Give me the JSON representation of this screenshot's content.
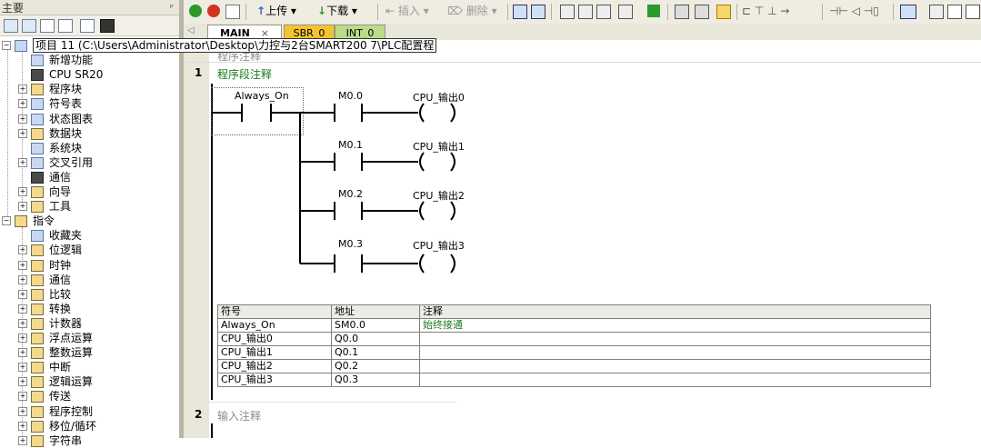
{
  "left_panel": {
    "title": "主要",
    "tree": [
      {
        "label": "项目 11 (C:\\Users\\Administrator\\Desktop\\力控与2台SMART200 7\\PLC配置程",
        "level": 0
      },
      {
        "label": "新增功能",
        "level": 1
      },
      {
        "label": "CPU SR20",
        "level": 1
      },
      {
        "label": "程序块",
        "level": 1
      },
      {
        "label": "符号表",
        "level": 1
      },
      {
        "label": "状态图表",
        "level": 1
      },
      {
        "label": "数据块",
        "level": 1
      },
      {
        "label": "系统块",
        "level": 1
      },
      {
        "label": "交叉引用",
        "level": 1
      },
      {
        "label": "通信",
        "level": 1
      },
      {
        "label": "向导",
        "level": 1
      },
      {
        "label": "工具",
        "level": 1
      },
      {
        "label": "指令",
        "level": 0
      },
      {
        "label": "收藏夹",
        "level": 1
      },
      {
        "label": "位逻辑",
        "level": 1
      },
      {
        "label": "时钟",
        "level": 1
      },
      {
        "label": "通信",
        "level": 1
      },
      {
        "label": "比较",
        "level": 1
      },
      {
        "label": "转换",
        "level": 1
      },
      {
        "label": "计数器",
        "level": 1
      },
      {
        "label": "浮点运算",
        "level": 1
      },
      {
        "label": "整数运算",
        "level": 1
      },
      {
        "label": "中断",
        "level": 1
      },
      {
        "label": "逻辑运算",
        "level": 1
      },
      {
        "label": "传送",
        "level": 1
      },
      {
        "label": "程序控制",
        "level": 1
      },
      {
        "label": "移位/循环",
        "level": 1
      },
      {
        "label": "字符串",
        "level": 1
      }
    ]
  },
  "toolbar": {
    "upload_label": "上传",
    "download_label": "下载",
    "insert_label": "插入",
    "delete_label": "删除"
  },
  "tabs": [
    {
      "label": "MAIN",
      "active": true,
      "color": "#ffffff"
    },
    {
      "label": "SBR_0",
      "active": false,
      "color": "#f4c430"
    },
    {
      "label": "INT_0",
      "active": false,
      "color": "#b9dc8a"
    }
  ],
  "editor": {
    "program_comment": "程序注释",
    "networks": [
      {
        "number": "1",
        "comment": "程序段注释",
        "contact_top": "Always_On",
        "rungs": [
          {
            "contact": "M0.0",
            "coil": "CPU_输出0"
          },
          {
            "contact": "M0.1",
            "coil": "CPU_输出1"
          },
          {
            "contact": "M0.2",
            "coil": "CPU_输出2"
          },
          {
            "contact": "M0.3",
            "coil": "CPU_输出3"
          }
        ],
        "symbol_table": {
          "headers": [
            "符号",
            "地址",
            "注释"
          ],
          "rows": [
            [
              "Always_On",
              "SM0.0",
              "始终接通"
            ],
            [
              "CPU_输出0",
              "Q0.0",
              ""
            ],
            [
              "CPU_输出1",
              "Q0.1",
              ""
            ],
            [
              "CPU_输出2",
              "Q0.2",
              ""
            ],
            [
              "CPU_输出3",
              "Q0.3",
              ""
            ]
          ]
        }
      },
      {
        "number": "2",
        "comment": "输入注释"
      }
    ]
  }
}
